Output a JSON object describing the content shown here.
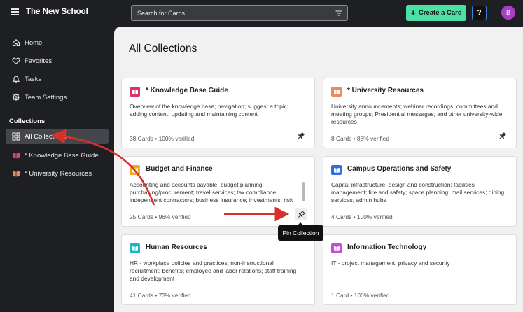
{
  "app": {
    "title": "The New School"
  },
  "search": {
    "placeholder": "Search for Cards"
  },
  "header": {
    "create_label": "Create a Card",
    "help_label": "?",
    "avatar_initial": "B"
  },
  "sidebar": {
    "items": [
      {
        "label": "Home",
        "icon": "home-icon"
      },
      {
        "label": "Favorites",
        "icon": "heart-icon"
      },
      {
        "label": "Tasks",
        "icon": "bell-icon"
      },
      {
        "label": "Team Settings",
        "icon": "gear-icon"
      }
    ],
    "collections_label": "Collections",
    "collections": [
      {
        "label": "All Collections",
        "icon": "grid-icon",
        "active": true
      },
      {
        "label": "* Knowledge Base Guide",
        "icon": "book-icon",
        "color": "#e0457b"
      },
      {
        "label": "* University Resources",
        "icon": "book-icon",
        "color": "#f08a5d"
      }
    ]
  },
  "main": {
    "title": "All Collections",
    "cards": [
      {
        "title": "* Knowledge Base Guide",
        "color": "#d6336c",
        "description": "Overview of the knowledge base; navigation; suggest a topic; adding content; updating and maintaining content",
        "meta": "38 Cards • 100% verified",
        "pinned": true
      },
      {
        "title": "* University Resources",
        "color": "#f08a5d",
        "description": "University announcements; webinar recordings; committees and meeting groups; Presidential messages; and other university-wide resources",
        "meta": "8 Cards • 88% verified",
        "pinned": true
      },
      {
        "title": "Budget and Finance",
        "color": "#f5a623",
        "description": "Accounting and accounts payable; budget planning; purchasing/procurement; travel services; tax compliance; independent contractors; business insurance; investments; risk",
        "meta": "25 Cards • 96% verified",
        "pinned": false
      },
      {
        "title": "Campus Operations and Safety",
        "color": "#2f6fe0",
        "description": "Capital infrastructure; design and construction; facilities management; fire and safety; space planning; mail services; dining services; admin hubs",
        "meta": "4 Cards • 100% verified",
        "pinned": false
      },
      {
        "title": "Human Resources",
        "color": "#1fb5c9",
        "description": "HR - workplace policies and practices; non-instructional recruitment; benefits; employee and labor relations; staff training and development",
        "meta": "41 Cards • 73% verified",
        "pinned": false
      },
      {
        "title": "Information Technology",
        "color": "#c54fd8",
        "description": "IT - project management; privacy and security",
        "meta": "1 Card • 100% verified",
        "pinned": false
      }
    ],
    "tooltip": "Pin Collection"
  },
  "colors": {
    "accent": "#4ce0a6",
    "annotation": "#d9302b"
  }
}
